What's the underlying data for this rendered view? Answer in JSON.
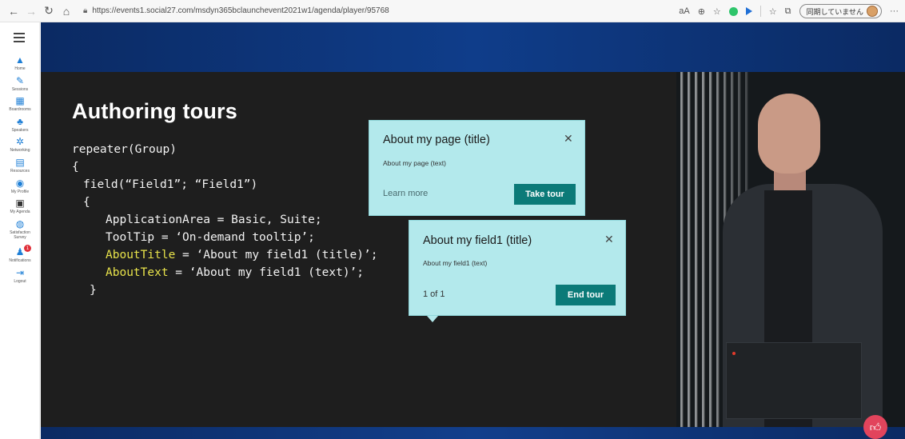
{
  "browser": {
    "back_icon": "back-arrow-icon",
    "forward_icon": "forward-arrow-icon",
    "url": "https://events1.social27.com/msdyn365bclaunchevent2021w1/agenda/player/95768",
    "sync_label": "同期していません"
  },
  "rail": {
    "items": [
      {
        "label": "Home",
        "icon": "home-icon"
      },
      {
        "label": "Sessions",
        "icon": "sessions-icon"
      },
      {
        "label": "Boardrooms",
        "icon": "boardrooms-icon"
      },
      {
        "label": "Speakers",
        "icon": "speakers-icon"
      },
      {
        "label": "Networking",
        "icon": "networking-icon"
      },
      {
        "label": "Resources",
        "icon": "resources-icon"
      },
      {
        "label": "My Profile",
        "icon": "profile-icon"
      },
      {
        "label": "My Agenda",
        "icon": "agenda-icon"
      },
      {
        "label": "Satisfaction Survey",
        "icon": "survey-icon"
      },
      {
        "label": "Notifications",
        "icon": "bell-icon"
      },
      {
        "label": "Logout",
        "icon": "logout-icon"
      }
    ],
    "notification_count": "1"
  },
  "slide": {
    "title": "Authoring tours",
    "code": {
      "l1": "repeater(Group)",
      "l2": "{",
      "l3": "field(“Field1”; “Field1”)",
      "l4": "{",
      "l5": "ApplicationArea = Basic, Suite;",
      "l6": "ToolTip = ‘On-demand tooltip’;",
      "l7_key": "AboutTitle",
      "l7_rest": " = ‘About my field1 (title)’;",
      "l8_key": "AboutText",
      "l8_rest": " = ‘About my field1 (text)’;",
      "l9": "}"
    },
    "tip_page": {
      "title": "About my page (title)",
      "text": "About my page (text)",
      "link": "Learn more",
      "button": "Take tour",
      "close": "✕"
    },
    "tip_field": {
      "title": "About my field1 (title)",
      "text": "About my field1 (text)",
      "count": "1 of 1",
      "button": "End tour",
      "close": "✕"
    }
  },
  "colors": {
    "teal_button": "#0b7a78",
    "tip_bg": "#b3e9ec",
    "code_highlight": "#e6e14a",
    "like_button": "#e2445c"
  }
}
